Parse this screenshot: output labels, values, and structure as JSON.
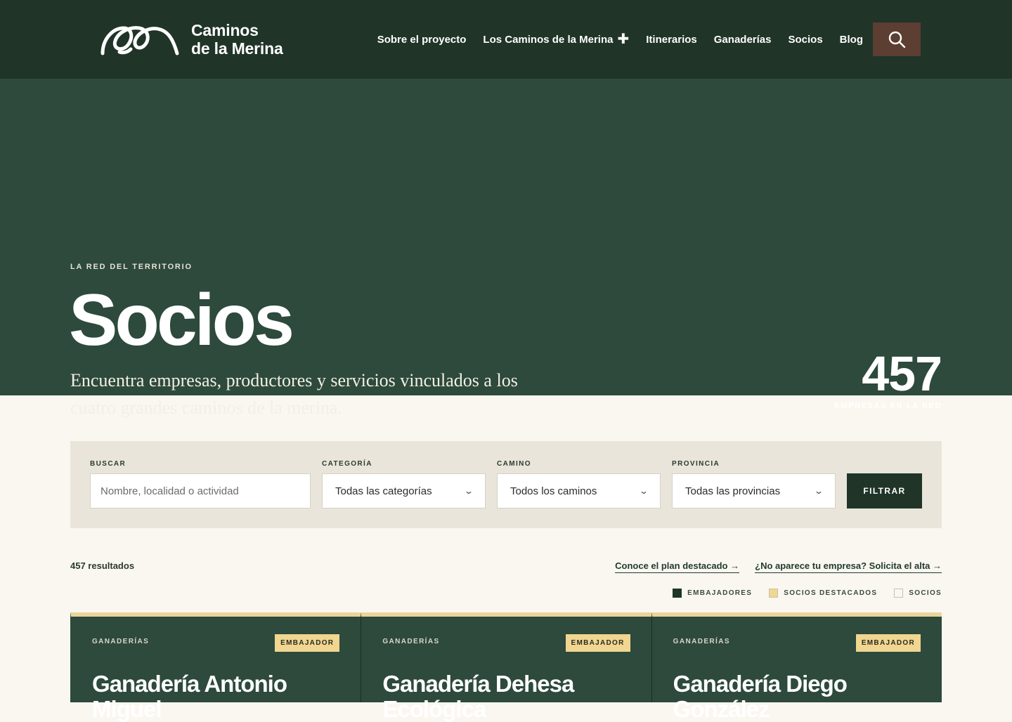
{
  "header": {
    "logo_line1": "Caminos",
    "logo_line2": "de la Merina",
    "nav": [
      {
        "label": "Sobre el proyecto"
      },
      {
        "label": "Los Caminos de la Merina",
        "icon": "plus-icon"
      },
      {
        "label": "Itinerarios"
      },
      {
        "label": "Ganaderías"
      },
      {
        "label": "Socios"
      },
      {
        "label": "Blog"
      }
    ],
    "search_icon": "search-icon"
  },
  "hero": {
    "eyebrow": "LA RED DEL TERRITORIO",
    "title": "Socios",
    "description": "Encuentra empresas, productores y servicios vinculados a los cuatro grandes caminos de la merina.",
    "stat_number": "457",
    "stat_label": "EMPRESAS EN LA RED"
  },
  "filters": {
    "search_label": "BUSCAR",
    "search_placeholder": "Nombre, localidad o actividad",
    "category_label": "CATEGORÍA",
    "category_value": "Todas las categorías",
    "road_label": "CAMINO",
    "road_value": "Todos los caminos",
    "province_label": "PROVINCIA",
    "province_value": "Todas las provincias",
    "submit_label": "FILTRAR"
  },
  "results": {
    "count": "457 resultados",
    "link_plan": "Conoce el plan destacado →",
    "link_signup": "¿No aparece tu empresa? Solicita el alta →",
    "legend": [
      {
        "label": "EMBAJADORES",
        "color": "#203428"
      },
      {
        "label": "SOCIOS DESTACADOS",
        "color": "#f0d690"
      },
      {
        "label": "SOCIOS",
        "color": "#faf7f0"
      }
    ]
  },
  "cards": [
    {
      "category": "GANADERÍAS",
      "badge": "EMBAJADOR",
      "title": "Ganadería Antonio Miguel"
    },
    {
      "category": "GANADERÍAS",
      "badge": "EMBAJADOR",
      "title": "Ganadería Dehesa Ecológica"
    },
    {
      "category": "GANADERÍAS",
      "badge": "EMBAJADOR",
      "title": "Ganadería Diego González"
    }
  ],
  "colors": {
    "header_bg": "#203428",
    "hero_bg": "#2d4a3c",
    "accent": "#f0d690",
    "search_button": "#5c3e32"
  }
}
